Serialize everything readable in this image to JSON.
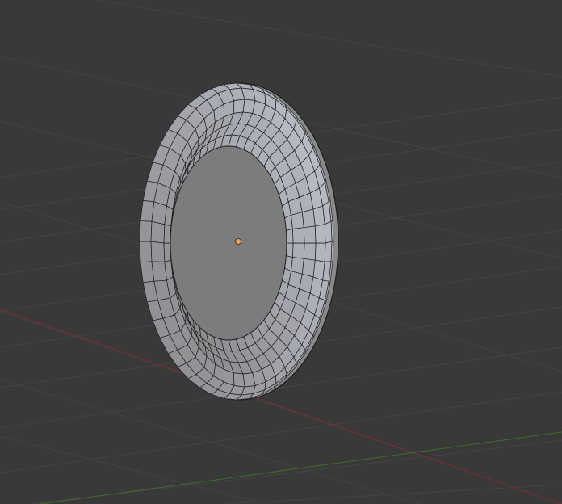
{
  "viewport": {
    "kind": "3d-viewport",
    "mode": "object"
  },
  "colors": {
    "background": "#393939",
    "grid_line": "#444444",
    "x_axis": "#7a2d31",
    "y_axis": "#3f6e2b",
    "mesh_face": "#8a8a8a",
    "mesh_face_light": "#b9bcc4",
    "mesh_wire": "#1f1f1f",
    "hub_face": "#7c7c7c",
    "origin_dot": "#f0a050"
  },
  "scene": {
    "object": {
      "shape": "tire",
      "display": "wireframe-over-solid",
      "selected": false
    },
    "origin_marker": "origin-dot-icon",
    "grid_floor": true,
    "axes_visible": [
      "x",
      "y"
    ]
  }
}
